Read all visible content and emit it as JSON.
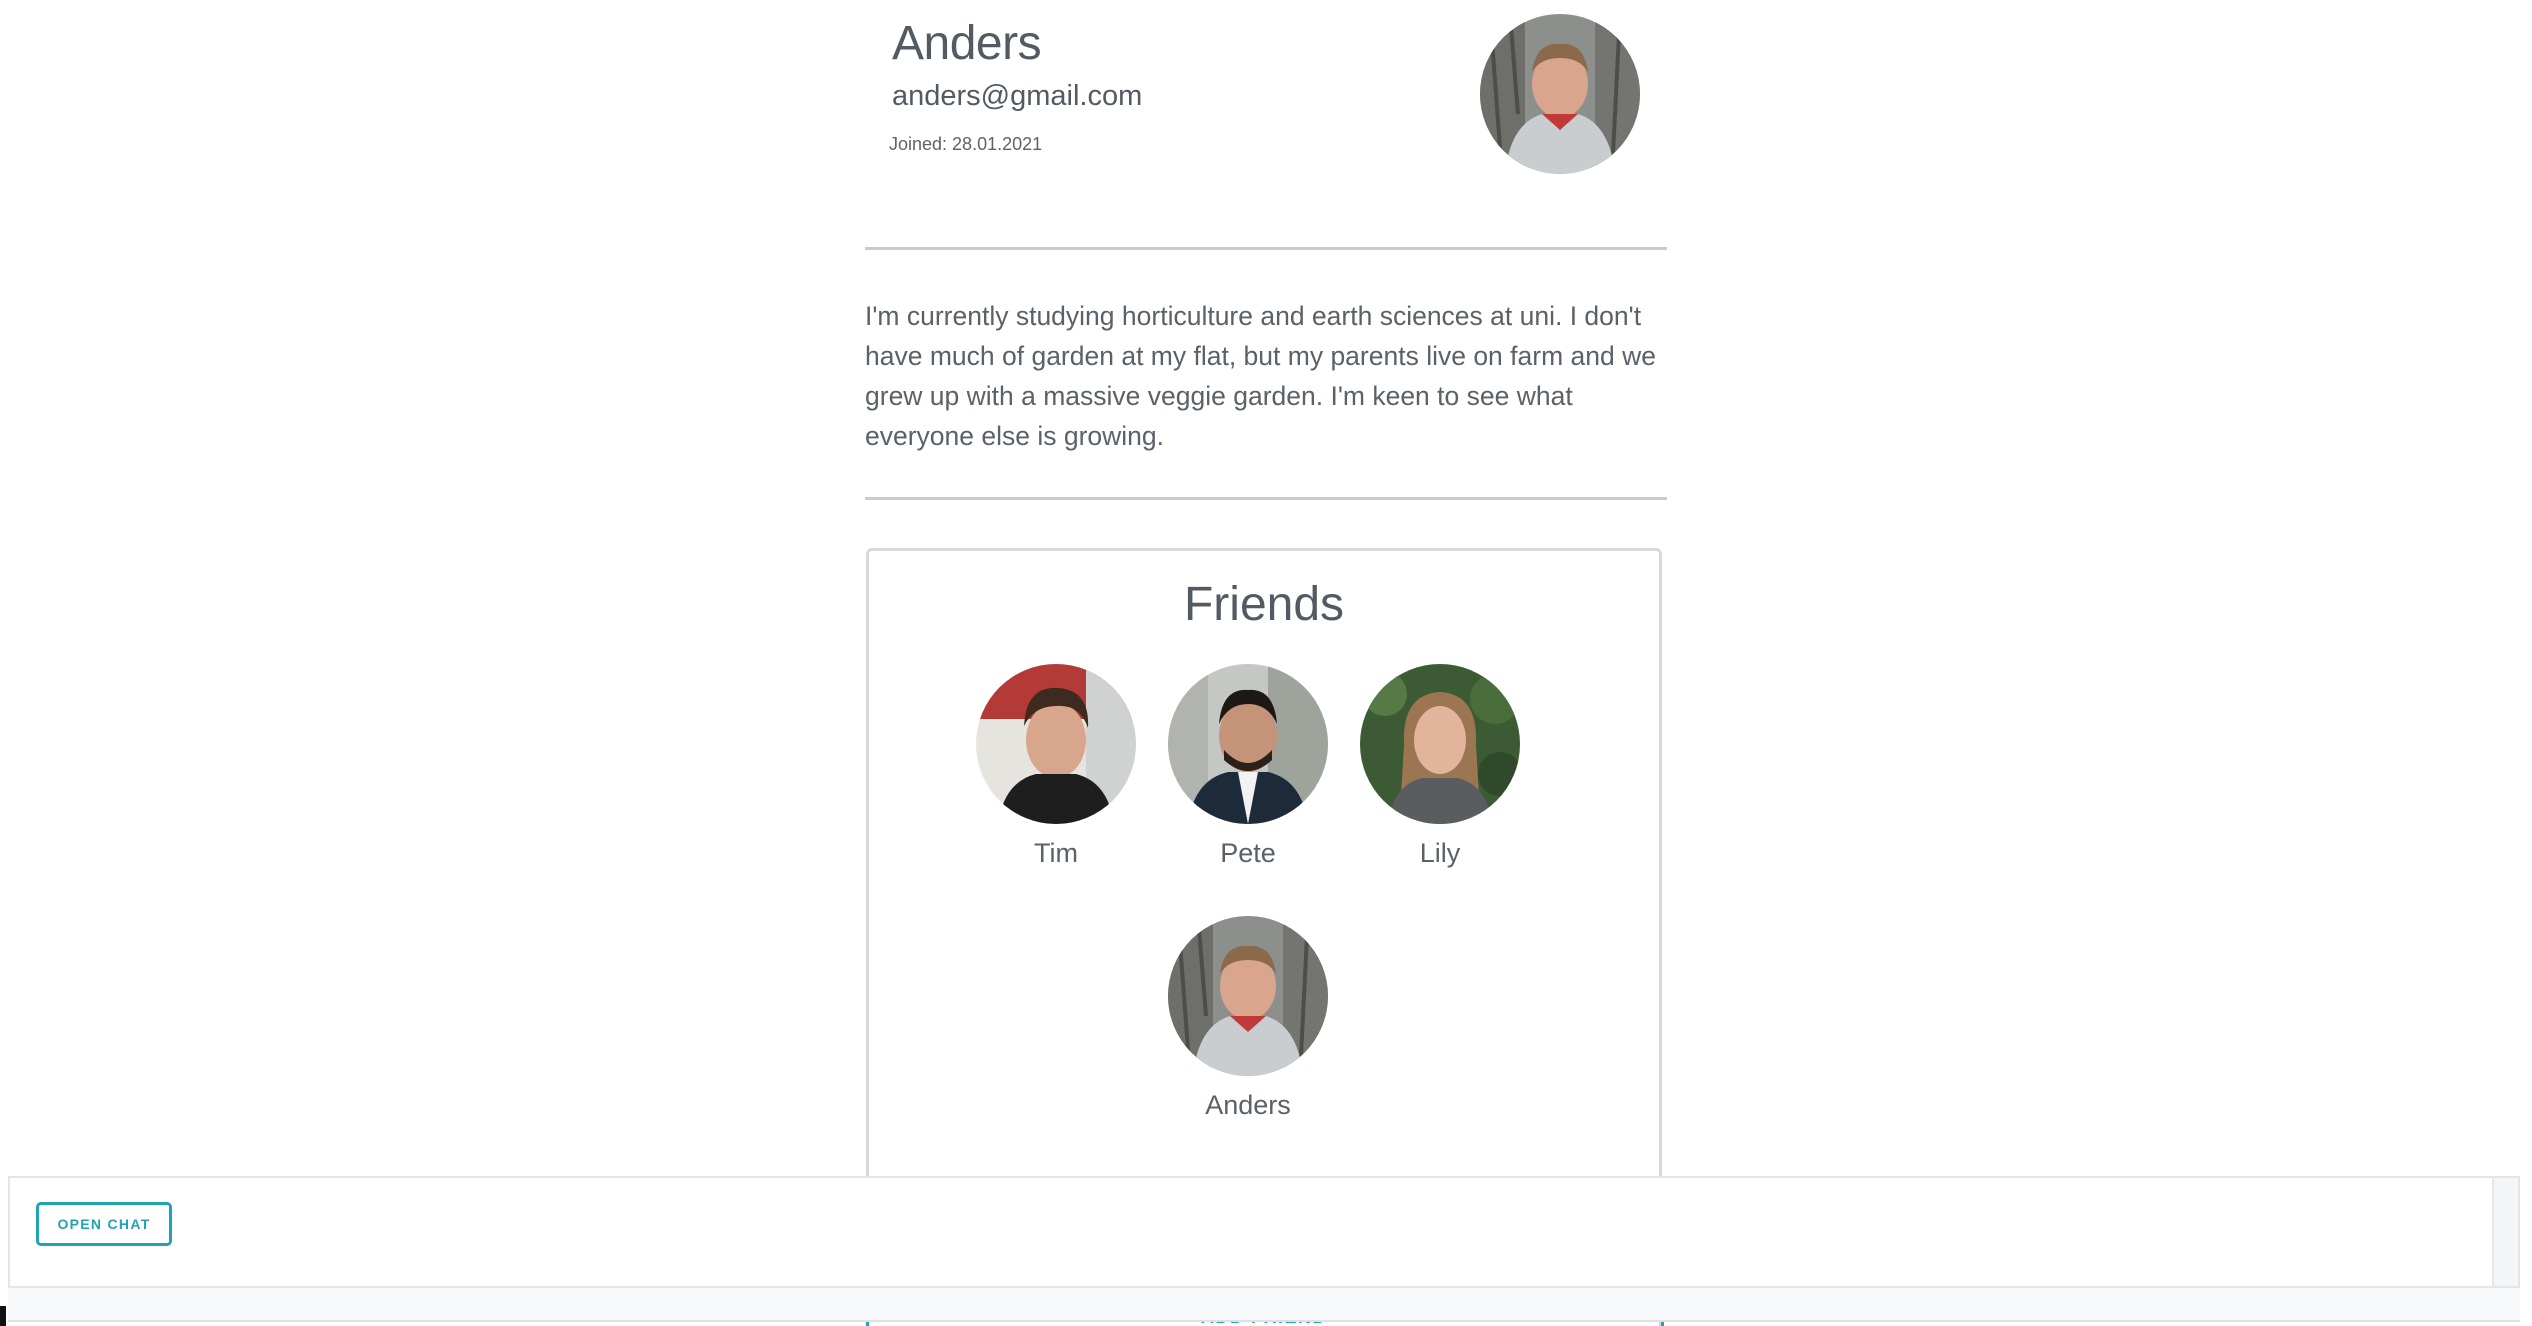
{
  "profile": {
    "name": "Anders",
    "email": "anders@gmail.com",
    "joined": "Joined: 28.01.2021",
    "bio": "I'm currently studying horticulture and earth sciences at uni. I don't have much of garden at my flat, but my parents live on farm and we grew up with a massive veggie garden. I'm keen to see what everyone else is growing."
  },
  "friends": {
    "title": "Friends",
    "items": [
      {
        "name": "Tim"
      },
      {
        "name": "Pete"
      },
      {
        "name": "Lily"
      },
      {
        "name": "Anders"
      }
    ],
    "add_friend_label": "ADD FRIEND"
  },
  "chat": {
    "open_label": "OPEN CHAT"
  },
  "colors": {
    "accent": "#22a3b3",
    "text": "#525a63",
    "divider": "#c9cbcd"
  }
}
